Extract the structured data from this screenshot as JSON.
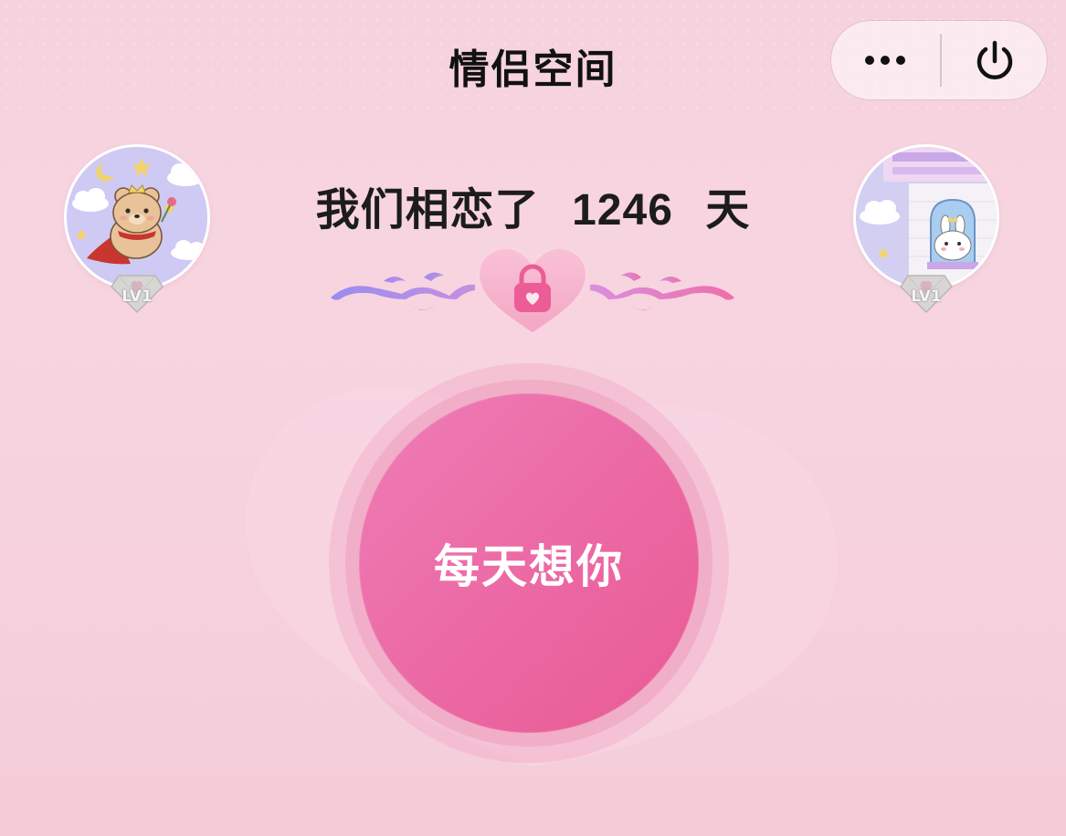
{
  "header": {
    "title": "情侣空间",
    "more_icon": "more-dots-icon",
    "power_icon": "power-icon"
  },
  "couple": {
    "left_avatar": {
      "icon": "bear-prince-avatar",
      "level": "LV1"
    },
    "right_avatar": {
      "icon": "bunny-window-avatar",
      "level": "LV1"
    }
  },
  "love_days": {
    "prefix": "我们相恋了",
    "count": "1246",
    "suffix": "天"
  },
  "ornament": {
    "icon": "heart-lock-icon"
  },
  "main_button": {
    "label": "每天想你"
  },
  "colors": {
    "background": "#f6d2de",
    "button_pink": "#ec6aa5",
    "ornament_purple": "#9a8cf0",
    "ornament_pink": "#ee6fa8"
  }
}
